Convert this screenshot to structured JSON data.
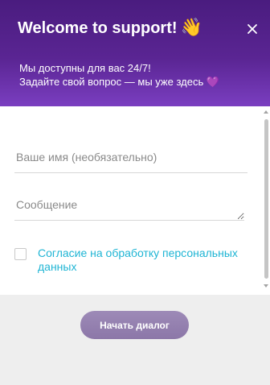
{
  "header": {
    "title": "Welcome to support!",
    "title_emoji": "👋",
    "subtitle_line1": "Мы доступны для вас 24/7!",
    "subtitle_line2": "Задайте свой вопрос — мы уже здесь",
    "heart_emoji": "💜",
    "close_icon": "close-icon",
    "colors": {
      "gradient_top": "#4a1c7f",
      "gradient_bottom": "#7a3ec0"
    }
  },
  "form": {
    "name_field": {
      "placeholder": "Ваше имя (необязательно)",
      "value": ""
    },
    "message_field": {
      "placeholder": "Сообщение",
      "value": ""
    },
    "consent": {
      "label": "Согласие на обработку персональных данных",
      "checked": false,
      "color": "#1fb5d4"
    }
  },
  "footer": {
    "start_button_label": "Начать диалог",
    "button_color": "#9480ae"
  }
}
